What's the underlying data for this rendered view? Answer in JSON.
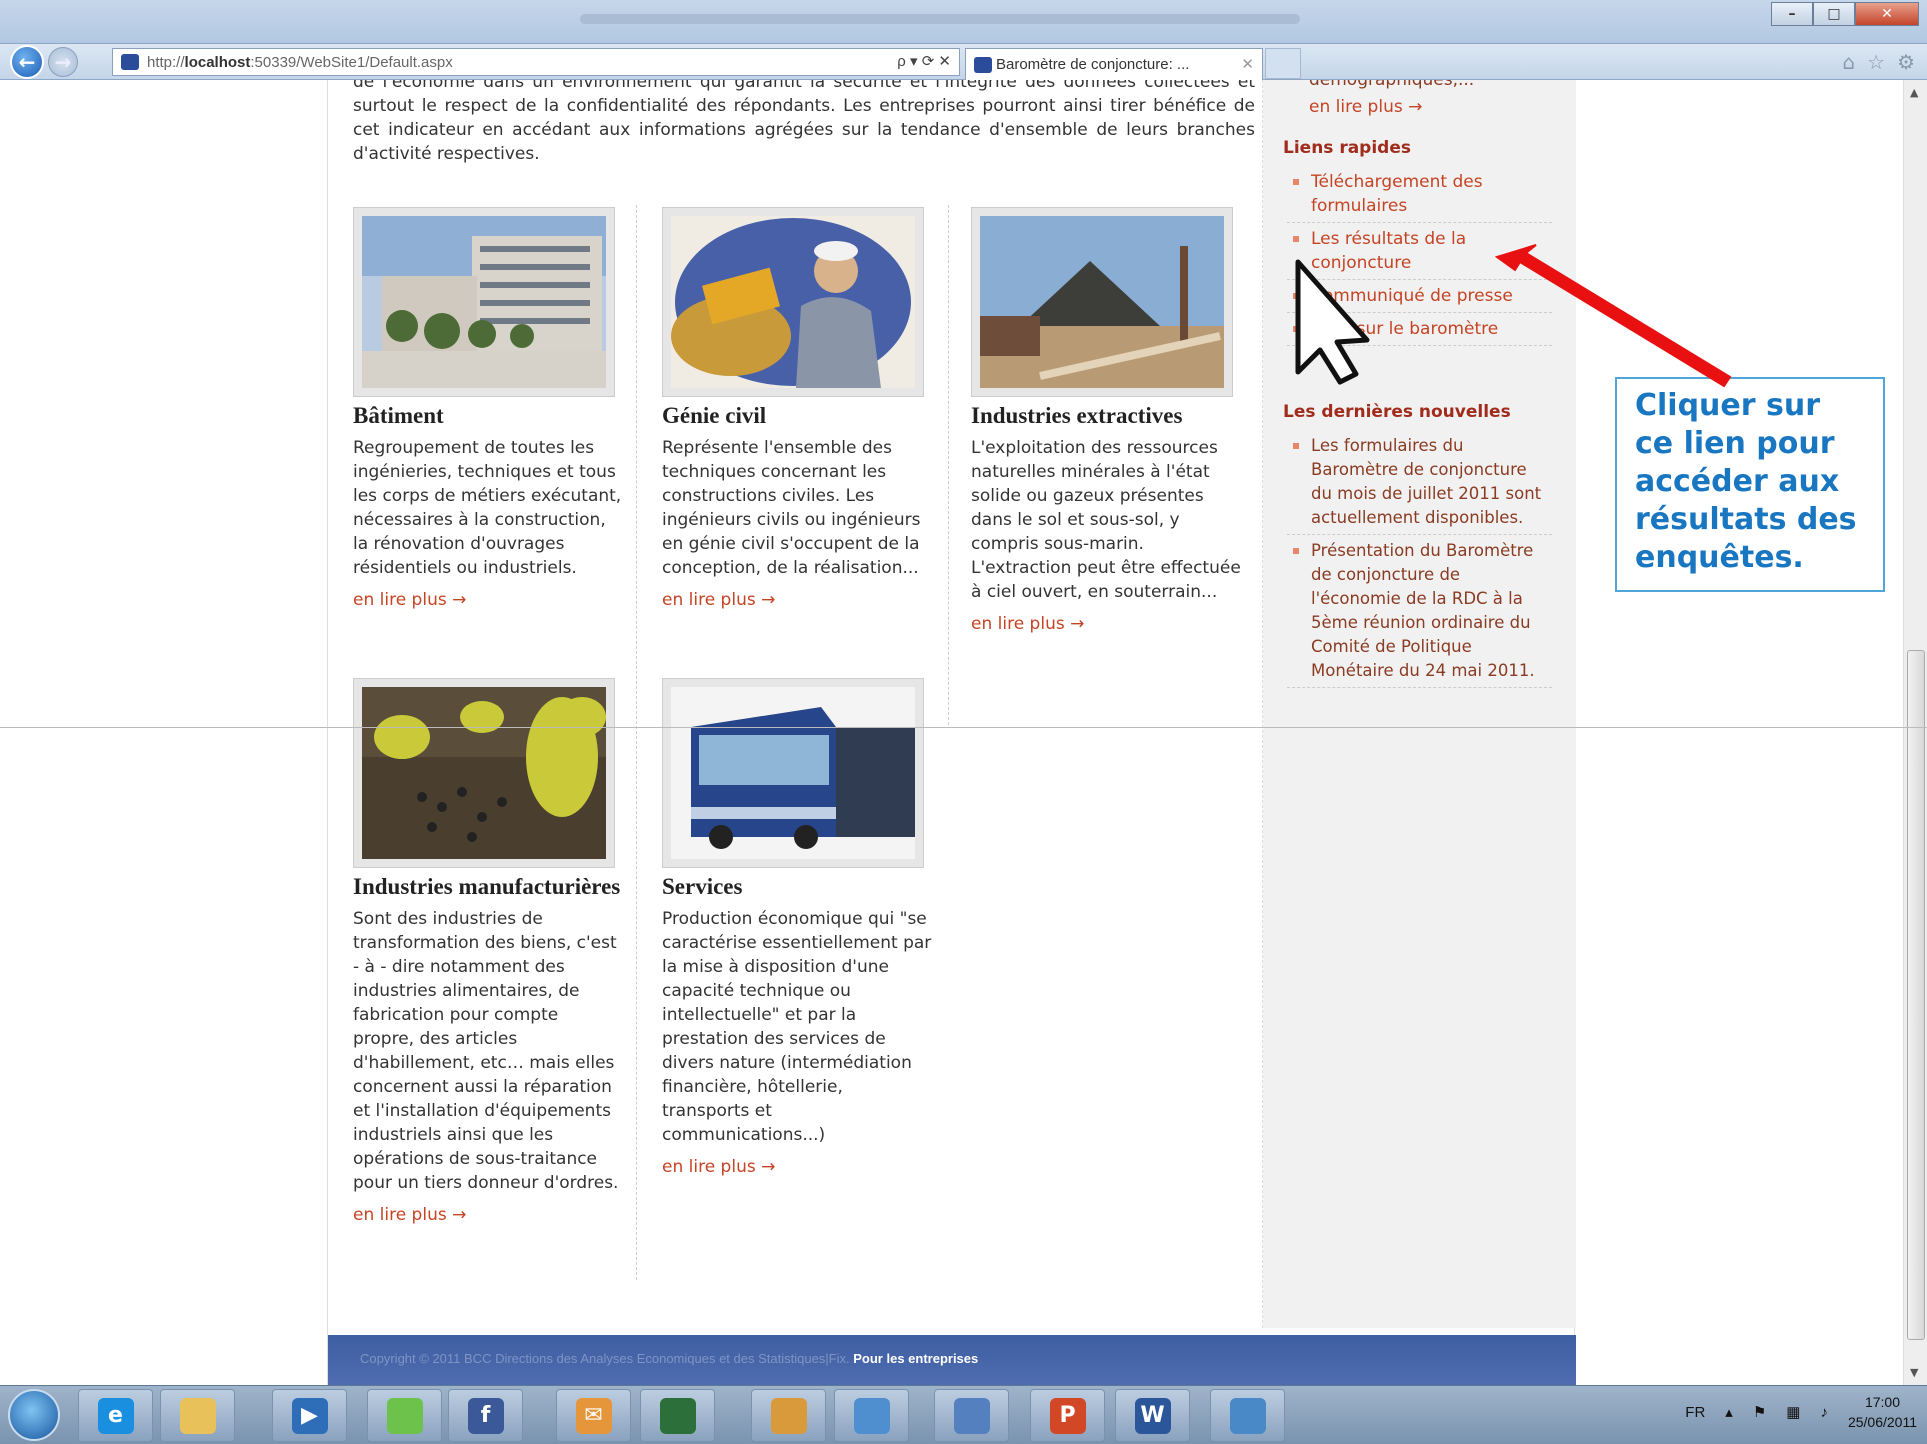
{
  "browser": {
    "url_host": "http://",
    "url_bold": "localhost",
    "url_rest": ":50339/WebSite1/Default.aspx",
    "tab_title": "Baromètre de conjoncture: ...",
    "address_tools": "ρ ▾ ⟳ ✕"
  },
  "intro": "de l'économie dans un environnement qui garantit la sécurité et l'intégrité des données collectées et surtout le respect de la confidentialité des répondants. Les entreprises pourront ainsi tirer bénéfice de cet indicateur en accédant aux informations agrégées sur la tendance d'ensemble de leurs branches d'activité respectives.",
  "sectors": [
    {
      "title": "Bâtiment",
      "text": "Regroupement de toutes les ingénieries, techniques et tous les corps de métiers exécutant, nécessaires à la construction, la rénovation d'ouvrages résidentiels ou industriels.",
      "more": "en lire plus →"
    },
    {
      "title": "Génie civil",
      "text": "Représente l'ensemble des techniques concernant les constructions civiles. Les ingénieurs civils ou ingénieurs en génie civil s'occupent de la conception, de la réalisation...",
      "more": "en lire plus →"
    },
    {
      "title": "Industries extractives",
      "text": "L'exploitation des ressources naturelles minérales à l'état solide ou gazeux présentes dans le sol et sous-sol, y compris sous-marin. L'extraction peut être effectuée à ciel ouvert, en souterrain...",
      "more": "en lire plus →"
    },
    {
      "title": "Industries manufacturières",
      "text": "Sont des industries de transformation des biens, c'est - à - dire notamment des industries alimentaires, de fabrication pour compte propre, des articles d'habillement, etc… mais elles concernent aussi la réparation et l'installation d'équipements industriels ainsi que les opérations de sous-traitance pour un tiers donneur d'ordres.",
      "more": "en lire plus →"
    },
    {
      "title": "Services",
      "text": "Production économique qui \"se caractérise essentiellement par la mise à disposition d'une capacité technique ou intellectuelle\" et par la prestation des services de divers nature (intermédiation financière, hôtellerie, transports et communications...)",
      "more": "en lire plus →"
    }
  ],
  "sidebar": {
    "top_text": "démographiques,...",
    "top_more": "en lire plus →",
    "links_title": "Liens rapides",
    "links": [
      "Téléchargement des formulaires",
      "Les résultats de la conjoncture",
      "Communiqué de presse",
      "Note sur le baromètre"
    ],
    "news_title": "Les dernières nouvelles",
    "news": [
      "Les formulaires du Baromètre de conjoncture du mois de juillet 2011 sont actuellement disponibles.",
      "Présentation du Baromètre de conjoncture de l'économie de la RDC à la 5ème réunion ordinaire du Comité de Politique Monétaire du 24 mai 2011."
    ]
  },
  "footer": {
    "copyright": "Copyright © 2011 BCC Directions des Analyses Economiques et des Statistiques|Fix.",
    "link": "Pour les entreprises"
  },
  "callout": "Cliquer sur ce lien pour accéder aux résultats des enquêtes.",
  "tray": {
    "lang": "FR",
    "time": "17:00",
    "date": "25/06/2011"
  },
  "colors": {
    "accent": "#c54424",
    "callout_text": "#1976c0",
    "arrow": "#e81010",
    "footer": "#3e5fa2"
  }
}
